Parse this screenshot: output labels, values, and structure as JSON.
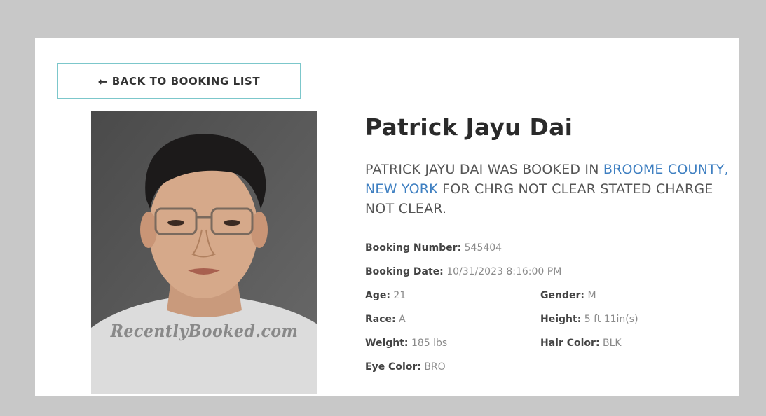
{
  "back_button": {
    "icon": "arrow-left-icon",
    "label": "BACK TO BOOKING LIST"
  },
  "photo": {
    "watermark": "RecentlyBooked.com"
  },
  "name": "Patrick Jayu Dai",
  "summary": {
    "part1": "PATRICK JAYU DAI WAS BOOKED IN ",
    "location": "BROOME COUNTY, NEW YORK",
    "part2": " FOR CHRG NOT CLEAR STATED CHARGE NOT CLEAR."
  },
  "details": {
    "booking_number": {
      "label": "Booking Number:",
      "value": "545404"
    },
    "booking_date": {
      "label": "Booking Date:",
      "value": "10/31/2023 8:16:00 PM"
    },
    "age": {
      "label": "Age:",
      "value": "21"
    },
    "gender": {
      "label": "Gender:",
      "value": "M"
    },
    "race": {
      "label": "Race:",
      "value": "A"
    },
    "height": {
      "label": "Height:",
      "value": "5 ft 11in(s)"
    },
    "weight": {
      "label": "Weight:",
      "value": "185 lbs"
    },
    "hair_color": {
      "label": "Hair Color:",
      "value": "BLK"
    },
    "eye_color": {
      "label": "Eye Color:",
      "value": "BRO"
    }
  },
  "colors": {
    "page_background": "#c8c8c8",
    "card_background": "#ffffff",
    "button_border": "#7cc7cb",
    "link": "#3e7fc1",
    "heading": "#2a2a2a",
    "summary_text": "#555555"
  }
}
